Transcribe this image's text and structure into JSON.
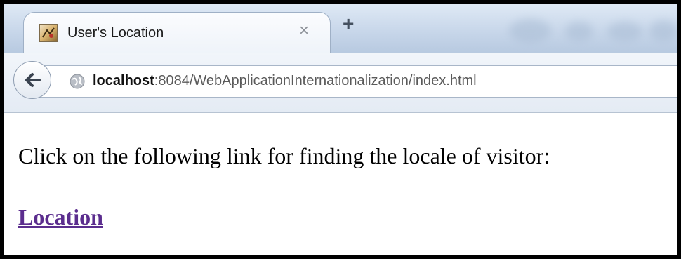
{
  "browser": {
    "tab": {
      "title": "User's Location",
      "close_glyph": "×",
      "favicon": "map-favicon-icon"
    },
    "new_tab_glyph": "+",
    "nav": {
      "back_icon": "back-arrow-icon",
      "site_icon": "globe-icon",
      "url_host": "localhost",
      "url_rest": ":8084/WebApplicationInternationalization/index.html"
    }
  },
  "page": {
    "prompt": "Click on the following link for finding the locale of visitor:",
    "link_label": "Location",
    "link_color": "#5b2d8e"
  }
}
